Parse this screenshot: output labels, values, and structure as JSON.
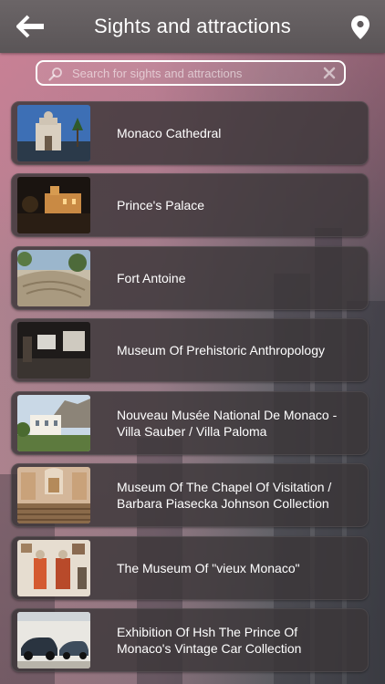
{
  "header": {
    "title": "Sights and attractions",
    "back_icon": "back-arrow-icon",
    "map_icon": "map-pin-icon"
  },
  "search": {
    "placeholder": "Search for sights and attractions",
    "value": ""
  },
  "items": [
    {
      "label": "Monaco Cathedral"
    },
    {
      "label": "Prince's Palace"
    },
    {
      "label": "Fort Antoine"
    },
    {
      "label": "Museum Of Prehistoric Anthropology"
    },
    {
      "label": "Nouveau Musée National De Monaco - Villa Sauber / Villa Paloma"
    },
    {
      "label": "Museum Of The Chapel Of Visitation / Barbara Piasecka Johnson Collection"
    },
    {
      "label": "The Museum Of \"vieux Monaco\""
    },
    {
      "label": "Exhibition Of Hsh The Prince Of Monaco's Vintage Car Collection"
    }
  ],
  "colors": {
    "header_bg": "#5f5a5c",
    "card_bg": "#3a3638",
    "text": "#ffffff"
  }
}
